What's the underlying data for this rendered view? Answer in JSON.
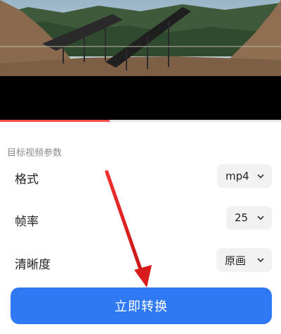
{
  "video": {
    "progress_fraction": 0.39
  },
  "section": {
    "label": "目标视频参数"
  },
  "params": [
    {
      "label": "格式",
      "value": "mp4"
    },
    {
      "label": "帧率",
      "value": "25"
    },
    {
      "label": "清晰度",
      "value": "原画"
    }
  ],
  "convert_button": {
    "label": "立即转换"
  },
  "colors": {
    "accent": "#2f79f5",
    "progress": "#ff4d4f",
    "annotation_arrow": "#e02020"
  }
}
